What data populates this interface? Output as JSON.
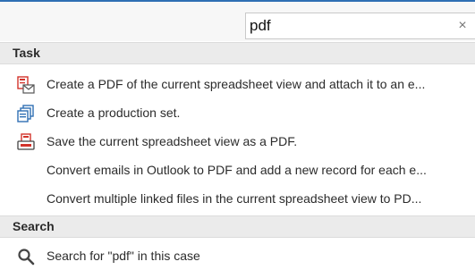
{
  "search": {
    "value": "pdf",
    "clear_glyph": "×"
  },
  "task_section": {
    "title": "Task",
    "items": [
      {
        "label": "Create a PDF of the current spreadsheet view and attach it to an e...",
        "icon": "pdf-email-icon"
      },
      {
        "label": "Create a production set.",
        "icon": "production-set-icon"
      },
      {
        "label": "Save the current spreadsheet view as a PDF.",
        "icon": "pdf-save-icon"
      },
      {
        "label": "Convert emails in Outlook to PDF and add a new record for each e...",
        "icon": ""
      },
      {
        "label": "Convert multiple linked files in the current spreadsheet view to PD...",
        "icon": ""
      }
    ]
  },
  "search_section": {
    "title": "Search",
    "items": [
      {
        "label": "Search for \"pdf\" in this case",
        "icon": "magnifier-icon"
      }
    ]
  },
  "colors": {
    "accent": "#2f6fb4",
    "pdf_red": "#d2332b",
    "header_bg": "#ebebeb"
  }
}
